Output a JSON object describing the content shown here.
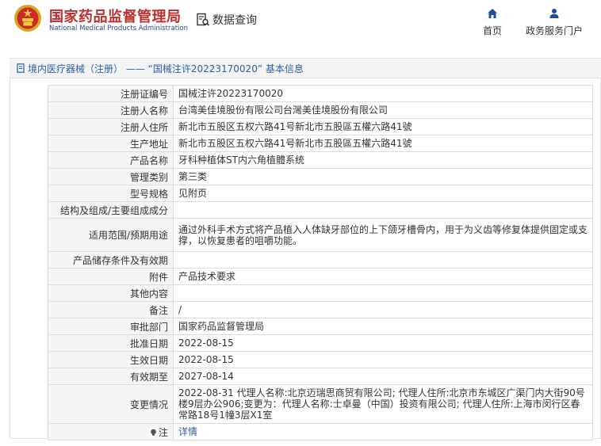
{
  "header": {
    "title_cn": "国家药品监督管理局",
    "title_en": "National Medical Products Administration",
    "query_label": "数据查询",
    "nav": [
      {
        "label": "首页",
        "icon": "home-icon"
      },
      {
        "label": "政务服务门户",
        "icon": "user-icon"
      }
    ]
  },
  "breadcrumb": "境内医疗器械（注册） —— “国械注许20223170020” 基本信息",
  "rows": [
    {
      "label": "注册证编号",
      "value": "国械注许20223170020"
    },
    {
      "label": "注册人名称",
      "value": "台湾美佳境股份有限公司台灣美佳境股份有限公司"
    },
    {
      "label": "注册人住所",
      "value": "新北市五股区五权六路41号新北市五股區五權六路41號"
    },
    {
      "label": "生产地址",
      "value": "新北市五股区五权六路41号新北市五股區五權六路41號"
    },
    {
      "label": "产品名称",
      "value": "牙科种植体ST内六角植體系统"
    },
    {
      "label": "管理类别",
      "value": "第三类"
    },
    {
      "label": "型号规格",
      "value": "见附页"
    },
    {
      "label": "结构及组成/主要组成成分",
      "value": ""
    },
    {
      "label": "适用范围/预期用途",
      "value": "通过外科手术方式将产品植入人体缺牙部位的上下颌牙槽骨内，用于为义齿等修复体提供固定或支撑，以恢复患者的咀嚼功能。"
    },
    {
      "label": "产品储存条件及有效期",
      "value": ""
    },
    {
      "label": "附件",
      "value": "产品技术要求"
    },
    {
      "label": "其他内容",
      "value": ""
    },
    {
      "label": "备注",
      "value": "/"
    },
    {
      "label": "审批部门",
      "value": "国家药品监督管理局"
    },
    {
      "label": "批准日期",
      "value": "2022-08-15"
    },
    {
      "label": "生效日期",
      "value": "2022-08-15"
    },
    {
      "label": "有效期至",
      "value": "2027-08-14"
    },
    {
      "label": "变更情况",
      "value": "2022-08-31 代理人名称:北京迈瑞思商贸有限公司; 代理人住所:北京市东城区广渠门内大街90号楼9层办公906;变更为：代理人名称:士卓曼（中国）投资有限公司; 代理人住所:上海市闵行区春常路18号1幢3层X1室"
    }
  ],
  "note": {
    "label": "注",
    "icon": "bulb-icon",
    "link": "详情"
  }
}
